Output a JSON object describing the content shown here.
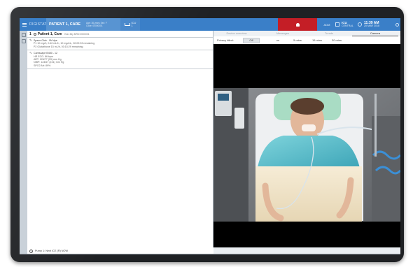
{
  "topbar": {
    "app_name": "DIGISTAT",
    "patient_name": "PATIENT 1, CARE",
    "patient_meta_1": "Age: 36 years    Sex: F",
    "patient_meta_2": "Code: 00000001",
    "bed_label": "ICU",
    "bed_number": "1",
    "admin_label": "ADM",
    "unit_name": "ICU",
    "unit_sub": "CENTRAL",
    "time": "11:39 AM",
    "date": "20 MAR 2018"
  },
  "patient_header": {
    "number": "1",
    "name": "Patient 1, Care",
    "sub": "Year 36y  MRN 0000001"
  },
  "pump_block": {
    "title": "Space Glob - 0M dye",
    "line1": "P1 10 mg/h, 0.40 mL/h, 10 mg/mL, 00:02:33 remaining",
    "line2": "P2 Glutathione 15 mL/h, 00:15:29 remaining"
  },
  "monitor_block": {
    "title": "Carescape B450 - 12",
    "hr": "HR ECG: 86 bpm",
    "art": "ART: 126/77 (93) mm Hg",
    "nibp": "NIBP: 124/67 (101) mm Hg",
    "spo2": "SPO2 Art: 89%"
  },
  "footer_text": "Pump 1: Next ICE (R) NOW",
  "tabs": [
    "Device overview",
    "Messages",
    "Trends",
    "Camera"
  ],
  "active_tab": "Camera",
  "privacy": {
    "label": "Privacy blind:",
    "options": [
      "Off",
      "on",
      "5 mins",
      "15 mins",
      "30 mins"
    ],
    "selected": "Off"
  },
  "colors": {
    "topbar": "#3a7fc8",
    "patient_tab": "#5894d2",
    "alarm": "#c41e26",
    "bezel": "#1f2124"
  },
  "icons": [
    "menu-icon",
    "bed-icon",
    "bell-icon",
    "unit-icon",
    "clock-icon",
    "user-icon",
    "pen-icon",
    "wave-icon",
    "info-icon"
  ]
}
